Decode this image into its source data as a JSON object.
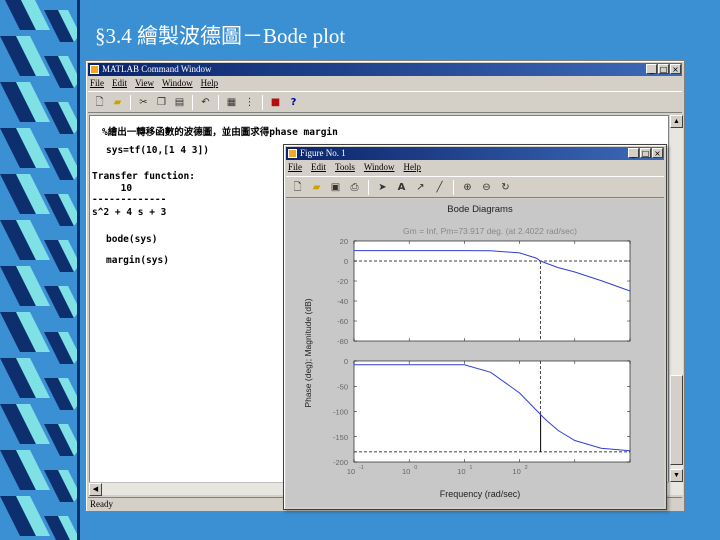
{
  "slide": {
    "title": "§3.4   繪製波德圖－Bode plot",
    "background": "#3b8fd3"
  },
  "command_window": {
    "title": "MATLAB Command Window",
    "menus": [
      "File",
      "Edit",
      "View",
      "Window",
      "Help"
    ],
    "toolbar_icons": [
      "new-file-icon",
      "open-folder-icon",
      "cut-icon",
      "copy-icon",
      "paste-icon",
      "undo-icon",
      "workspace-icon",
      "path-icon",
      "simulink-icon",
      "help-icon"
    ],
    "lines": [
      "%繪出一轉移函數的波德圖，並由圖求得phase margin",
      "sys=tf(10,[1 4 3])",
      "Transfer function:",
      "     10",
      "-------------",
      "s^2 + 4 s + 3",
      "bode(sys)",
      "margin(sys)"
    ],
    "status": "Ready"
  },
  "figure_window": {
    "title": "Figure No. 1",
    "menus": [
      "File",
      "Edit",
      "Tools",
      "Window",
      "Help"
    ],
    "toolbar_icons": [
      "new-figure-icon",
      "open-icon",
      "save-icon",
      "print-icon",
      "select-arrow-icon",
      "text-icon",
      "arrow-icon",
      "line-icon",
      "zoom-in-icon",
      "zoom-out-icon",
      "rotate-icon"
    ]
  },
  "chart_data": {
    "type": "line",
    "title": "Bode Diagrams",
    "subtitle": "Gm = Inf, Pm=73.917 deg. (at 2.4022 rad/sec)",
    "xlabel": "Frequency (rad/sec)",
    "ylabel": "Phase (deg); Magnitude (dB)",
    "xscale": "log",
    "xlim": [
      0.001,
      100
    ],
    "x_ticks": [
      "10",
      "10",
      "10",
      "10"
    ],
    "x_tick_exponents": [
      "-1",
      "0",
      "1",
      "2"
    ],
    "crossover_frequency": 2.4022,
    "magnitude": {
      "ylim": [
        -80,
        20
      ],
      "y_ticks": [
        "20",
        "0",
        "-20",
        "-40",
        "-60",
        "-80"
      ],
      "x": [
        0.1,
        0.3,
        1,
        2,
        2.4,
        3,
        5,
        10,
        30,
        100
      ],
      "y": [
        10.4,
        10.2,
        8.1,
        2.9,
        0.0,
        -2.1,
        -6.6,
        -11.0,
        -19.6,
        -30.0
      ]
    },
    "phase": {
      "ylim": [
        -200,
        0
      ],
      "y_ticks": [
        "0",
        "-50",
        "-100",
        "-150",
        "-200"
      ],
      "x": [
        0.1,
        0.3,
        1,
        2,
        2.4,
        3,
        5,
        10,
        30,
        100
      ],
      "y": [
        -7.6,
        -22.3,
        -63.4,
        -97.1,
        -106.1,
        -116.6,
        -137.7,
        -157.4,
        -172.6,
        -177.7
      ]
    },
    "line_color": "#2f3fd0",
    "reference_line_color": "#000000",
    "grid": false
  }
}
